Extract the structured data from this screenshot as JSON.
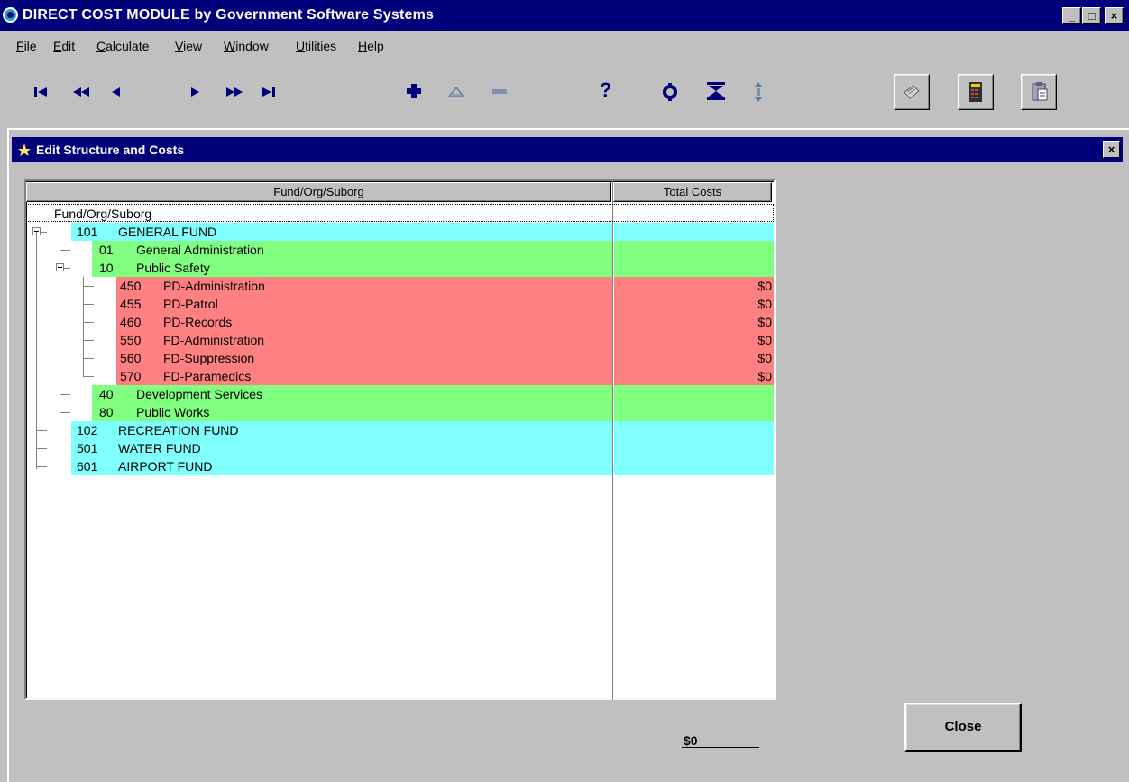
{
  "window": {
    "title": "DIRECT COST MODULE by Government Software Systems",
    "min_label": "_",
    "max_label": "□",
    "close_label": "×"
  },
  "menu": [
    {
      "label_pre": "",
      "acc": "F",
      "label_post": "ile"
    },
    {
      "label_pre": "",
      "acc": "E",
      "label_post": "dit"
    },
    {
      "label_pre": "",
      "acc": "C",
      "label_post": "alculate"
    },
    {
      "label_pre": "",
      "acc": "V",
      "label_post": "iew"
    },
    {
      "label_pre": "",
      "acc": "W",
      "label_post": "indow"
    },
    {
      "label_pre": "",
      "acc": "U",
      "label_post": "tilities"
    },
    {
      "label_pre": "",
      "acc": "H",
      "label_post": "elp"
    }
  ],
  "toolbar": {
    "icons": [
      "first-record-icon",
      "previous-page-icon",
      "previous-record-icon",
      "next-record-icon",
      "next-page-icon",
      "last-record-icon",
      "add-record-icon",
      "edit-record-icon",
      "delete-record-icon",
      "help-icon",
      "refresh-icon",
      "collapse-all-icon",
      "expand-all-icon",
      "report-icon",
      "calculator-icon",
      "clipboard-icon"
    ],
    "help_glyph": "?",
    "colors": {
      "nav": "#00007b",
      "add": "#00007b"
    }
  },
  "child_window": {
    "title": "Edit Structure and Costs",
    "close_label": "×"
  },
  "grid": {
    "col_name_header": "Fund/Org/Suborg",
    "col_cost_header": "Total Costs",
    "root_label": "Fund/Org/Suborg",
    "colors": {
      "fund": "#80ffff",
      "org": "#80ff80",
      "suborg": "#ff8080"
    },
    "rows": [
      {
        "level": 0,
        "code": "101",
        "name": "GENERAL FUND",
        "cost": "",
        "type": "fund",
        "expanded": true
      },
      {
        "level": 1,
        "code": "01",
        "name": "General Administration",
        "cost": "",
        "type": "org"
      },
      {
        "level": 1,
        "code": "10",
        "name": "Public Safety",
        "cost": "",
        "type": "org",
        "expanded": true
      },
      {
        "level": 2,
        "code": "450",
        "name": "PD-Administration",
        "cost": "$0",
        "type": "suborg"
      },
      {
        "level": 2,
        "code": "455",
        "name": "PD-Patrol",
        "cost": "$0",
        "type": "suborg"
      },
      {
        "level": 2,
        "code": "460",
        "name": "PD-Records",
        "cost": "$0",
        "type": "suborg"
      },
      {
        "level": 2,
        "code": "550",
        "name": "FD-Administration",
        "cost": "$0",
        "type": "suborg"
      },
      {
        "level": 2,
        "code": "560",
        "name": "FD-Suppression",
        "cost": "$0",
        "type": "suborg"
      },
      {
        "level": 2,
        "code": "570",
        "name": "FD-Paramedics",
        "cost": "$0",
        "type": "suborg"
      },
      {
        "level": 1,
        "code": "40",
        "name": "Development Services",
        "cost": "",
        "type": "org"
      },
      {
        "level": 1,
        "code": "80",
        "name": "Public Works",
        "cost": "",
        "type": "org"
      },
      {
        "level": 0,
        "code": "102",
        "name": "RECREATION FUND",
        "cost": "",
        "type": "fund"
      },
      {
        "level": 0,
        "code": "501",
        "name": "WATER FUND",
        "cost": "",
        "type": "fund"
      },
      {
        "level": 0,
        "code": "601",
        "name": "AIRPORT FUND",
        "cost": "",
        "type": "fund"
      }
    ]
  },
  "footer": {
    "total": "$0",
    "close_label": "Close"
  }
}
